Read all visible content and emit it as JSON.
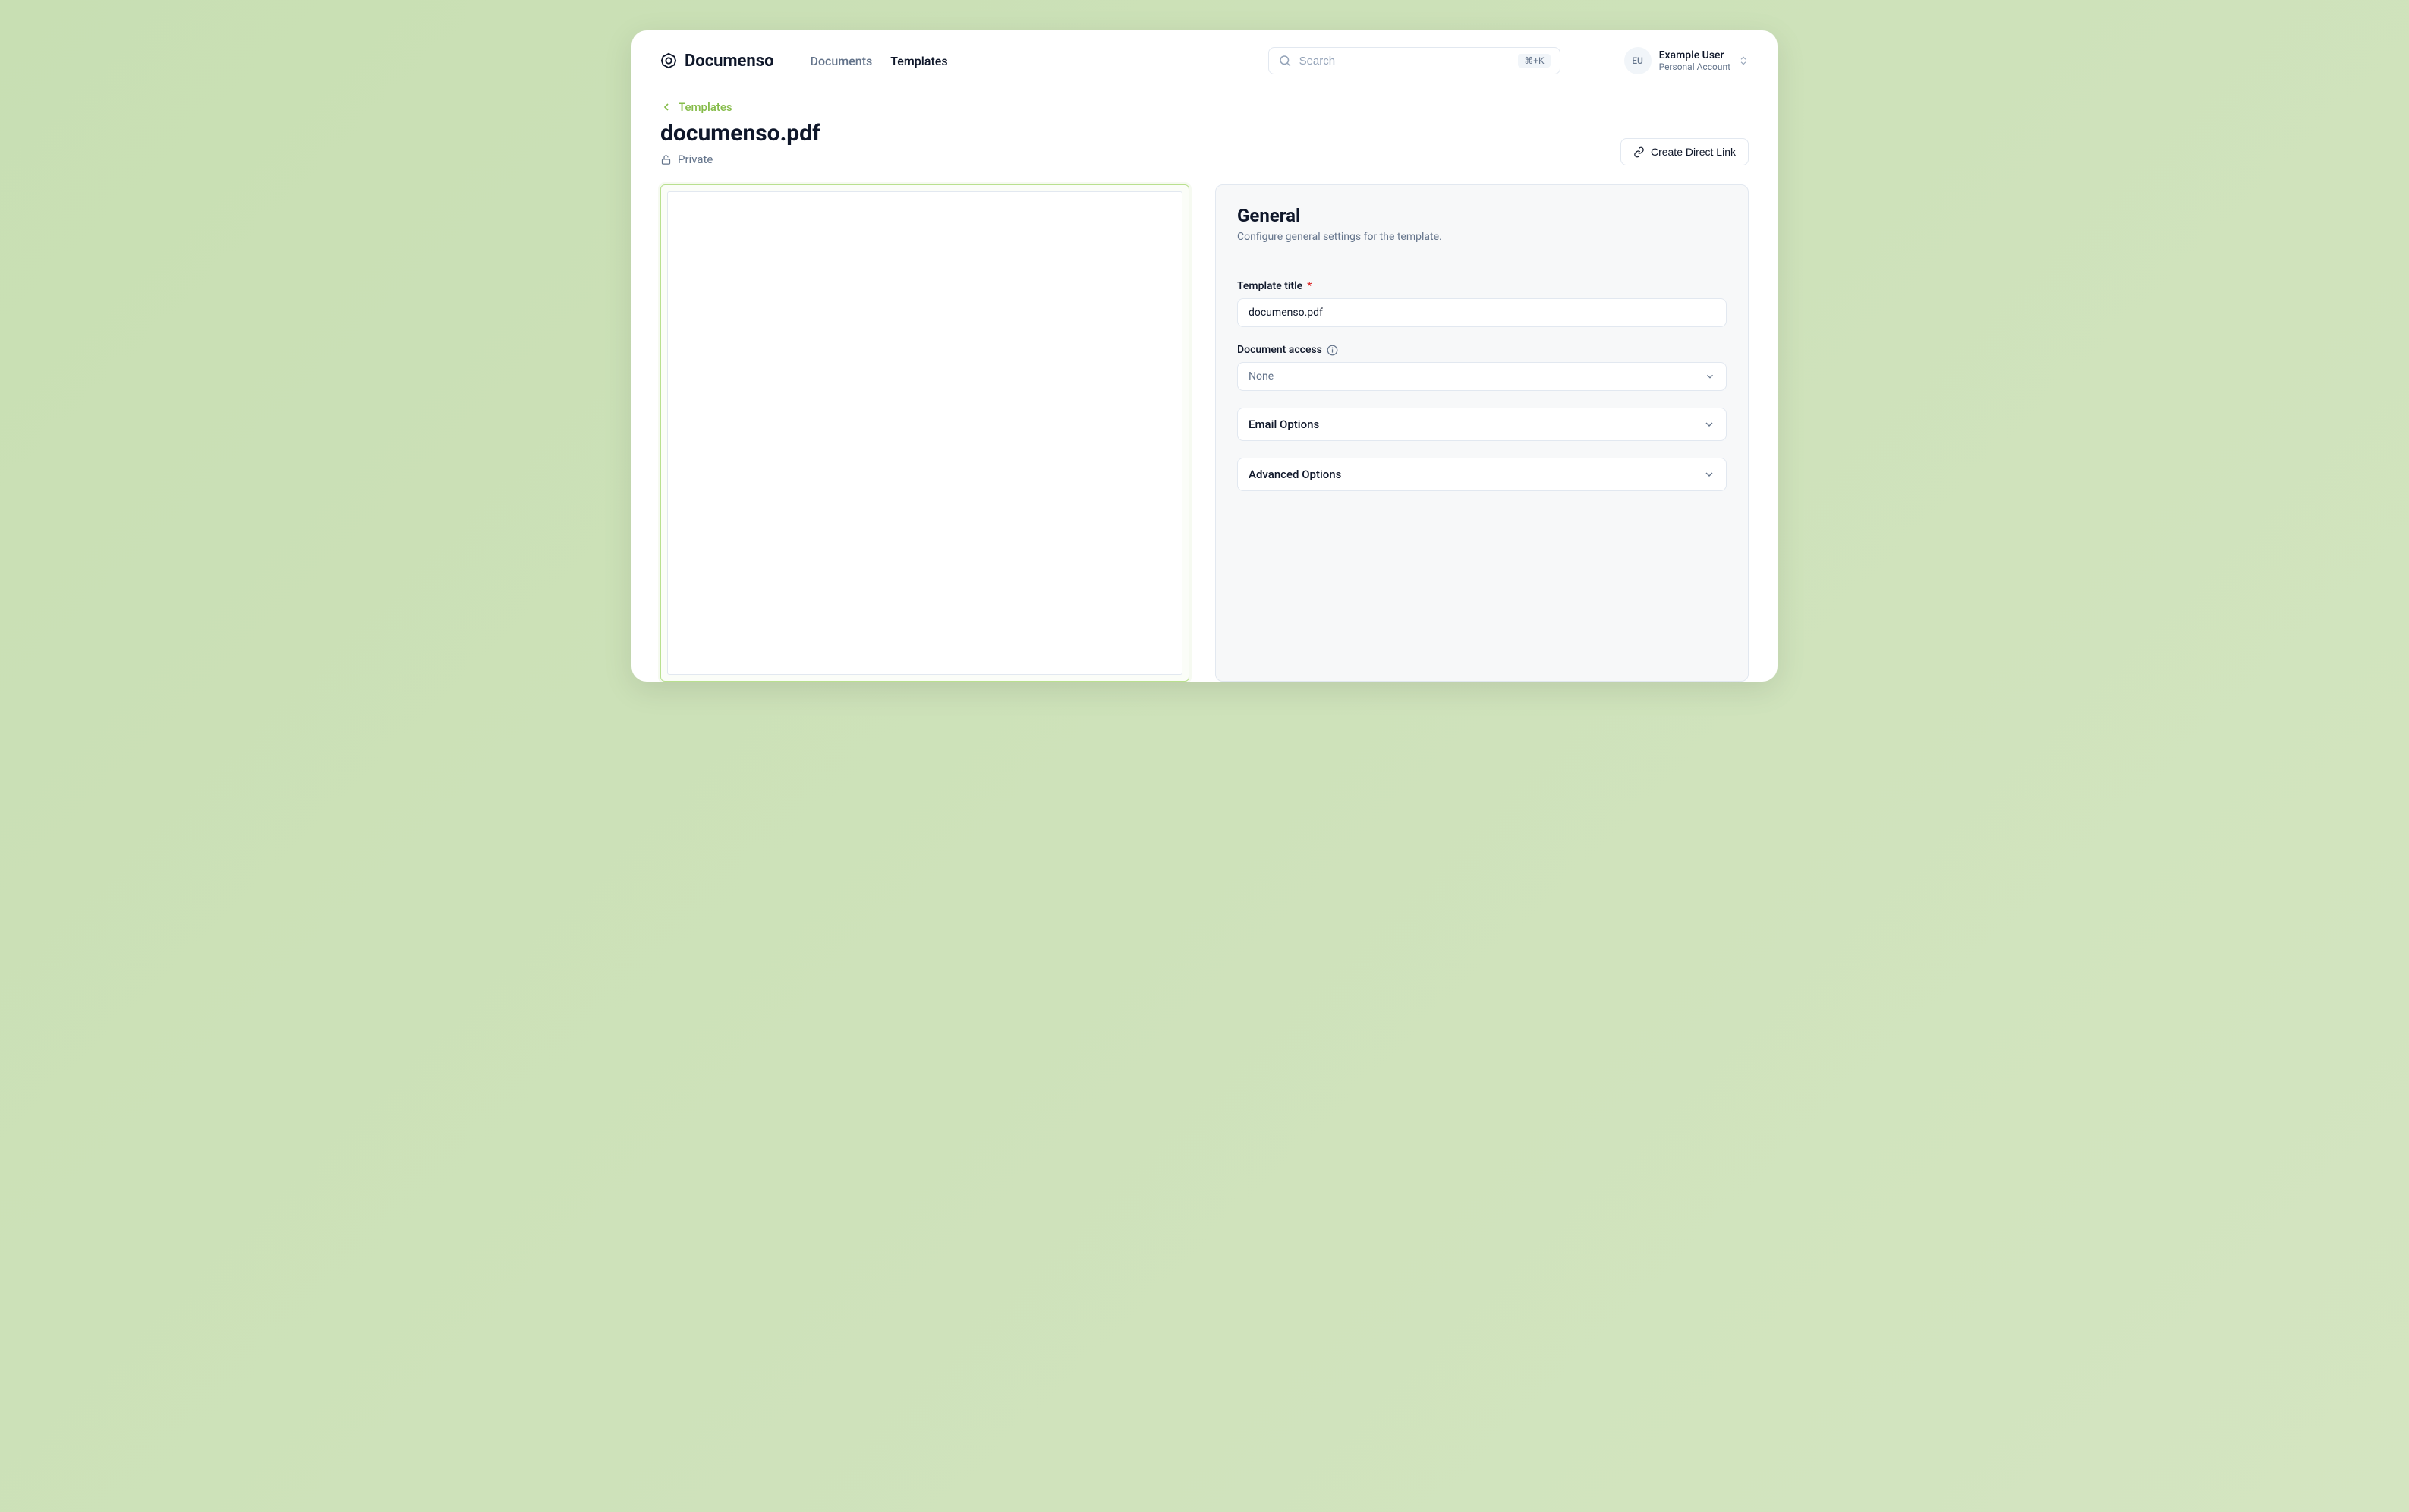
{
  "header": {
    "brand": "Documenso",
    "nav": {
      "documents": "Documents",
      "templates": "Templates"
    },
    "search": {
      "placeholder": "Search",
      "shortcut": "⌘+K"
    },
    "user": {
      "initials": "EU",
      "name": "Example User",
      "subtitle": "Personal Account"
    }
  },
  "breadcrumb": {
    "label": "Templates"
  },
  "page": {
    "title": "documenso.pdf",
    "visibility": "Private",
    "directLinkButton": "Create Direct Link"
  },
  "panel": {
    "title": "General",
    "subtitle": "Configure general settings for the template.",
    "fields": {
      "templateTitle": {
        "label": "Template title",
        "value": "documenso.pdf"
      },
      "documentAccess": {
        "label": "Document access",
        "value": "None"
      }
    },
    "accordions": {
      "email": "Email Options",
      "advanced": "Advanced Options"
    }
  }
}
